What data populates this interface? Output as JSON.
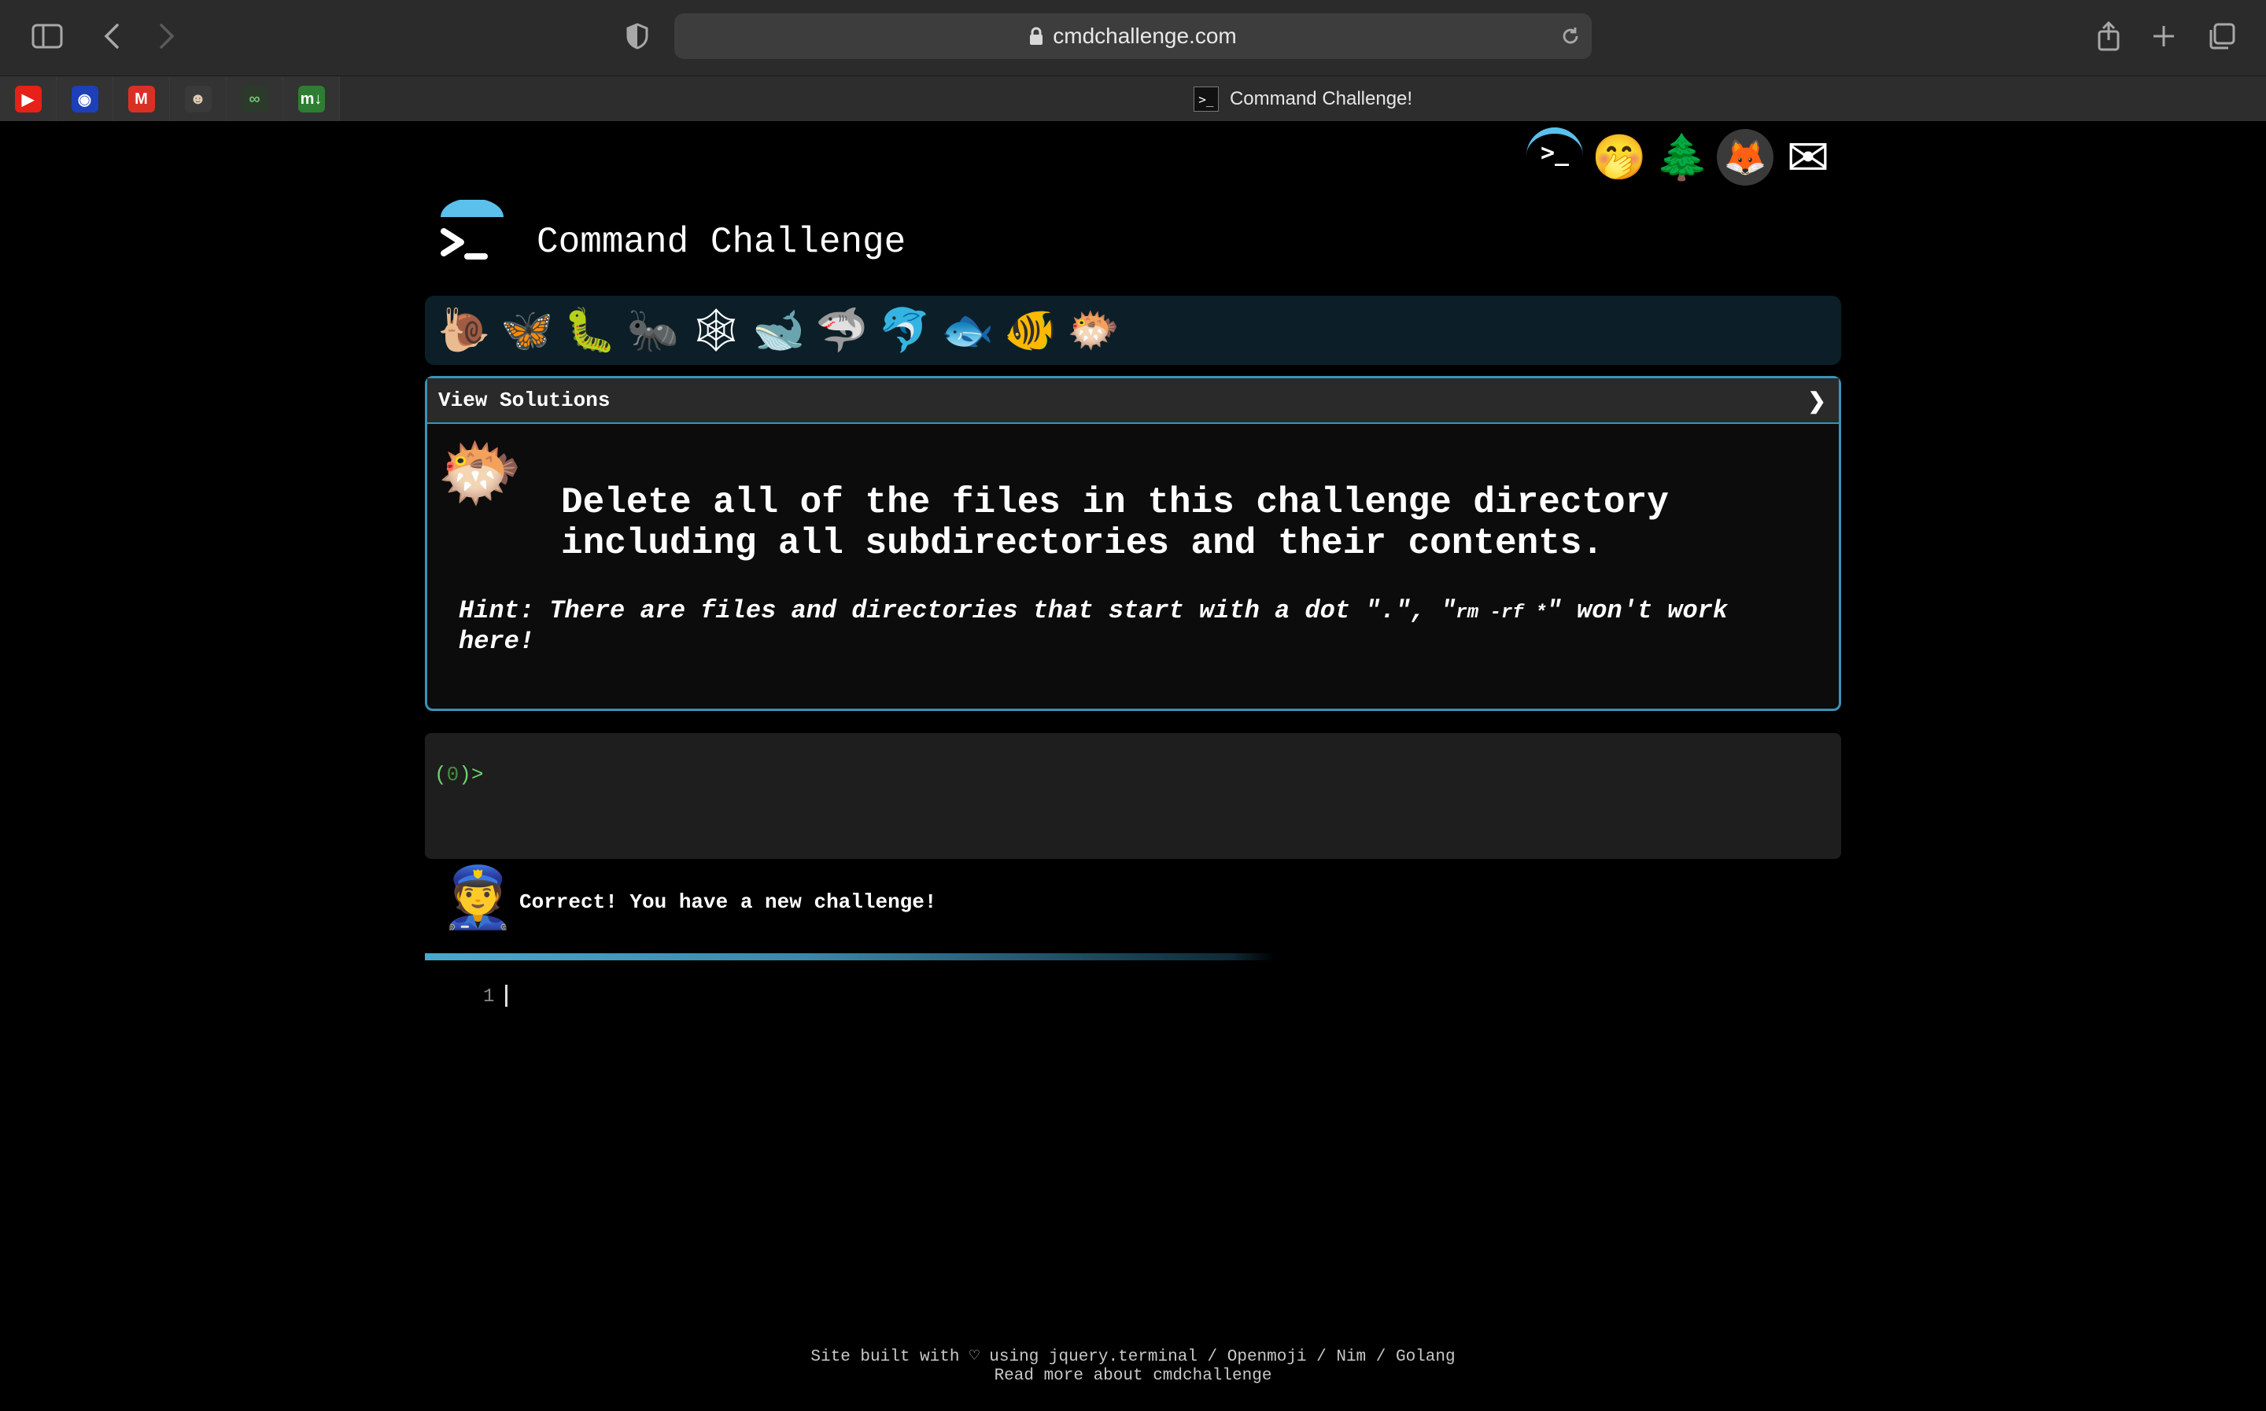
{
  "browser": {
    "url": "cmdchallenge.com",
    "active_tab_title": "Command Challenge!",
    "active_tab_favicon": ">_",
    "pinned_tabs": [
      {
        "name": "youtube",
        "glyph": "▶",
        "bg": "#e62117",
        "fg": "#ffffff"
      },
      {
        "name": "crunchyroll-like",
        "glyph": "◉",
        "bg": "#1d3fb8",
        "fg": "#ffffff"
      },
      {
        "name": "gmail",
        "glyph": "M",
        "bg": "#d93025",
        "fg": "#ffffff"
      },
      {
        "name": "avatar-site",
        "glyph": "☻",
        "bg": "#3a3a3a",
        "fg": "#e0c8b0"
      },
      {
        "name": "infinity-site",
        "glyph": "∞",
        "bg": "#2c3a2c",
        "fg": "#6cc06c"
      },
      {
        "name": "md-site",
        "glyph": "m↓",
        "bg": "#2e7d32",
        "fg": "#ffffff"
      }
    ]
  },
  "top_icons": [
    {
      "name": "terminal-icon",
      "glyph": ">_"
    },
    {
      "name": "shush-face-icon",
      "glyph": "🤭"
    },
    {
      "name": "tree-icon",
      "glyph": "🌲"
    },
    {
      "name": "gitlab-icon",
      "glyph": "🦊"
    },
    {
      "name": "mail-icon",
      "glyph": "✉"
    }
  ],
  "site": {
    "title": "Command Challenge"
  },
  "levels": [
    {
      "name": "snail-icon",
      "glyph": "🐌"
    },
    {
      "name": "butterfly-icon",
      "glyph": "🦋"
    },
    {
      "name": "caterpillar-icon",
      "glyph": "🐛"
    },
    {
      "name": "ant-icon",
      "glyph": "🐜"
    },
    {
      "name": "spider-web-icon",
      "glyph": "🕸"
    },
    {
      "name": "whale-icon",
      "glyph": "🐋"
    },
    {
      "name": "shark-icon",
      "glyph": "🦈"
    },
    {
      "name": "dolphin-icon",
      "glyph": "🐬"
    },
    {
      "name": "fish-icon",
      "glyph": "🐟"
    },
    {
      "name": "tropical-fish-icon",
      "glyph": "🐠"
    },
    {
      "name": "blowfish-icon",
      "glyph": "🐡"
    }
  ],
  "challenge": {
    "view_solutions": "View Solutions",
    "chevron": "❯",
    "icon": "🐡",
    "description": "Delete all of the files in this challenge directory including all subdirectories and their contents.",
    "hint_prefix": "Hint: There are files and directories that start with a dot \".\", \"",
    "hint_code": "rm -rf *",
    "hint_suffix": "\" won't work here!"
  },
  "terminal": {
    "prompt_open": "(",
    "prompt_count": "0",
    "prompt_close": ")>"
  },
  "message": {
    "avatar": "👮",
    "text": "Correct! You have a new challenge!",
    "progress": 0.6
  },
  "editor": {
    "line_number": "1"
  },
  "footer": {
    "line1": "Site built with ♡ using jquery.terminal / Openmoji / Nim / Golang",
    "line2": "Read more about cmdchallenge"
  }
}
